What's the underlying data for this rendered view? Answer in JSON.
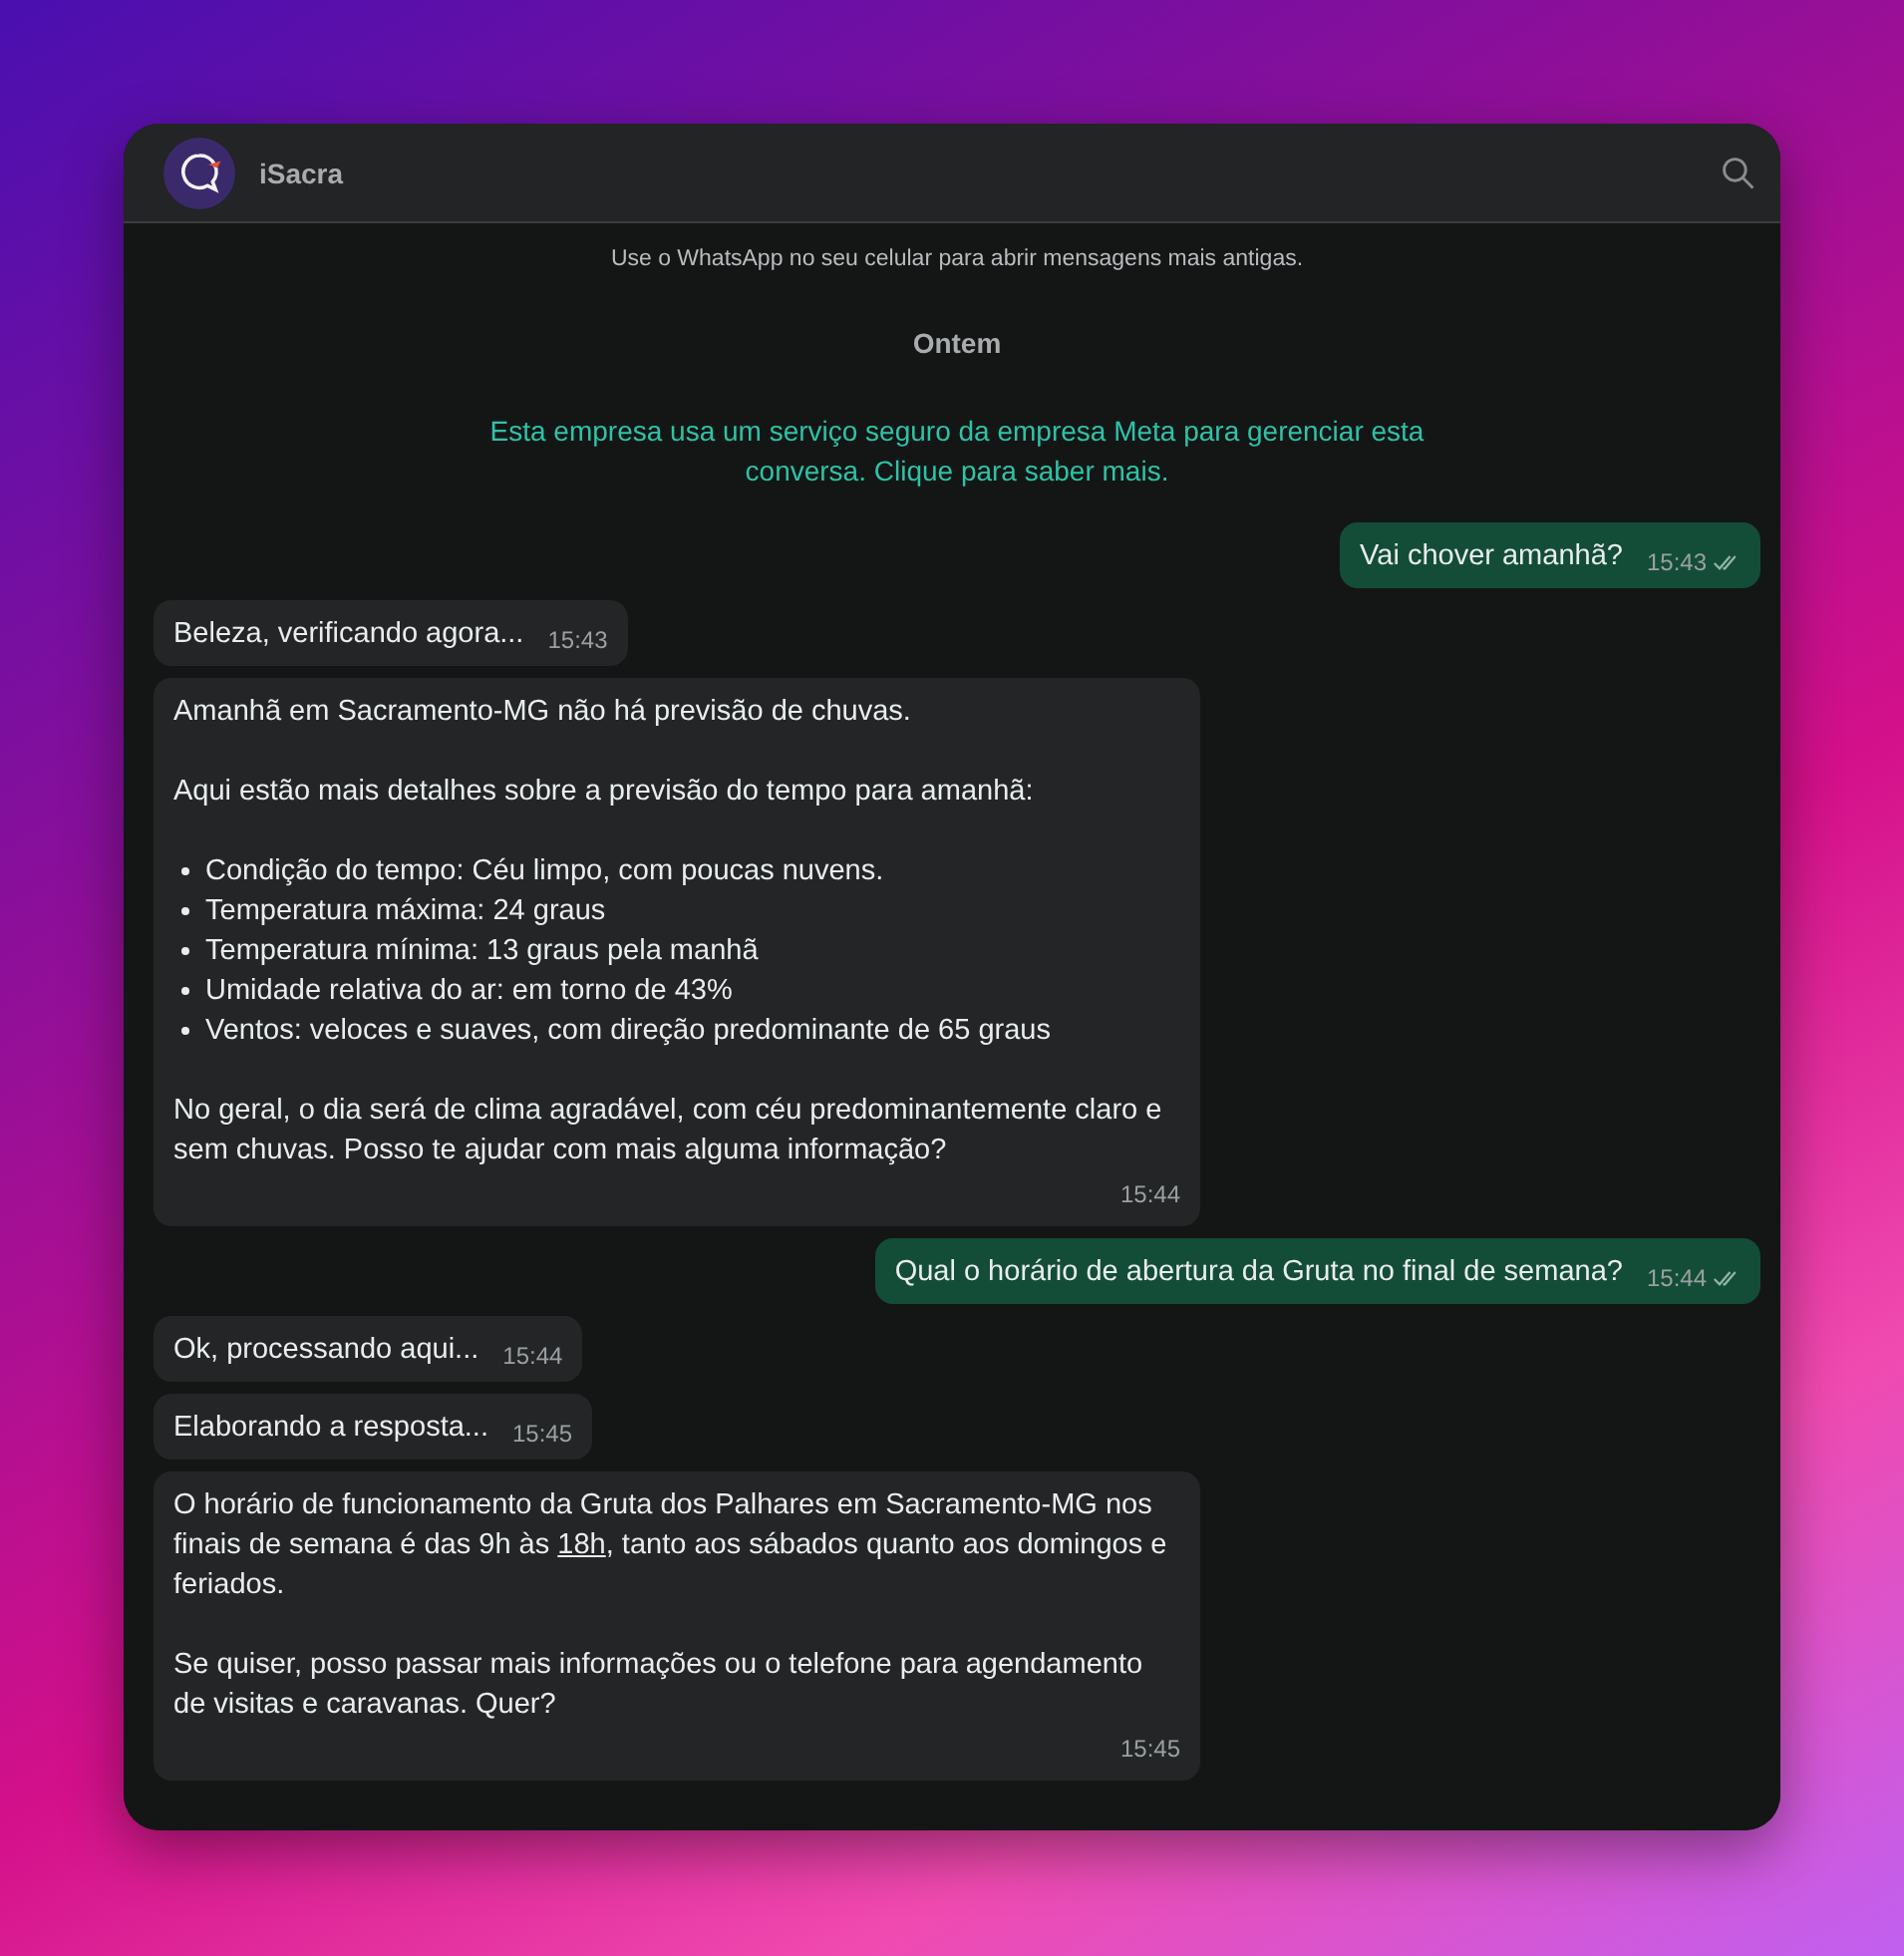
{
  "header": {
    "title": "iSacra"
  },
  "chat": {
    "notice": "Use o WhatsApp no seu celular para abrir mensagens mais antigas.",
    "date": "Ontem",
    "system": "Esta empresa usa um serviço seguro da empresa Meta para gerenciar esta conversa. Clique para saber mais.",
    "messages": [
      {
        "kind": "outgoing",
        "time": "15:43",
        "read": true,
        "blocks": [
          {
            "kind": "text",
            "parts": [
              {
                "text": "Vai chover amanhã?"
              }
            ]
          }
        ]
      },
      {
        "kind": "incoming",
        "time": "15:43",
        "blocks": [
          {
            "kind": "text",
            "parts": [
              {
                "text": "Beleza, verificando agora..."
              }
            ]
          }
        ]
      },
      {
        "kind": "incoming",
        "time": "15:44",
        "blocks": [
          {
            "kind": "text",
            "parts": [
              {
                "text": "Amanhã em Sacramento-MG não há previsão de chuvas."
              }
            ]
          },
          {
            "kind": "text",
            "parts": [
              {
                "text": "Aqui estão mais detalhes sobre a previsão do tempo para amanhã:"
              }
            ]
          },
          {
            "kind": "list",
            "items": [
              "Condição do tempo: Céu limpo, com poucas nuvens.",
              "Temperatura máxima: 24 graus",
              "Temperatura mínima: 13 graus pela manhã",
              "Umidade relativa do ar: em torno de 43%",
              "Ventos: veloces e suaves, com direção predominante de 65 graus"
            ]
          },
          {
            "kind": "text",
            "parts": [
              {
                "text": "No geral, o dia será de clima agradável, com céu predominantemente claro e sem chuvas. Posso te ajudar com mais alguma informação?"
              }
            ]
          }
        ]
      },
      {
        "kind": "outgoing",
        "time": "15:44",
        "read": true,
        "blocks": [
          {
            "kind": "text",
            "parts": [
              {
                "text": "Qual o horário de abertura da Gruta no final de semana?"
              }
            ]
          }
        ]
      },
      {
        "kind": "incoming",
        "time": "15:44",
        "blocks": [
          {
            "kind": "text",
            "parts": [
              {
                "text": "Ok, processando aqui..."
              }
            ]
          }
        ]
      },
      {
        "kind": "incoming",
        "time": "15:45",
        "blocks": [
          {
            "kind": "text",
            "parts": [
              {
                "text": "Elaborando a resposta..."
              }
            ]
          }
        ]
      },
      {
        "kind": "incoming",
        "time": "15:45",
        "blocks": [
          {
            "kind": "text",
            "parts": [
              {
                "text": "O horário de funcionamento da Gruta dos Palhares em Sacramento-MG nos finais de semana é das 9h às "
              },
              {
                "text": "18h",
                "link": true
              },
              {
                "text": ", tanto aos sábados quanto aos domingos e feriados."
              }
            ]
          },
          {
            "kind": "text",
            "parts": [
              {
                "text": "Se quiser, posso passar mais informações ou o telefone para agendamento de visitas e caravanas. Quer?"
              }
            ]
          }
        ]
      }
    ]
  }
}
